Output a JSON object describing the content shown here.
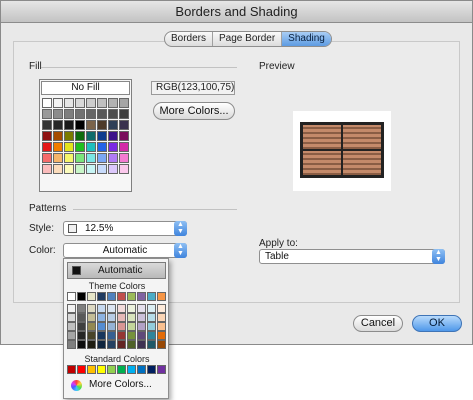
{
  "window": {
    "title": "Borders and Shading"
  },
  "tabs": [
    {
      "label": "Borders",
      "active": false
    },
    {
      "label": "Page Border",
      "active": false
    },
    {
      "label": "Shading",
      "active": true
    }
  ],
  "fill": {
    "section_label": "Fill",
    "no_fill_label": "No Fill",
    "rgb_readout": "RGB(123,100,75)",
    "more_colors_label": "More Colors...",
    "swatches": [
      "#ffffff",
      "#f2f2f2",
      "#e5e5e5",
      "#d8d8d8",
      "#cccccc",
      "#bfbfbf",
      "#b2b2b2",
      "#a5a5a5",
      "#999999",
      "#8c8c8c",
      "#7f7f7f",
      "#727272",
      "#666666",
      "#595959",
      "#4c4c4c",
      "#3f3f3f",
      "#333333",
      "#262626",
      "#191919",
      "#000000",
      "#7b644b",
      "#4d3b2a",
      "#2e3f56",
      "#39324d",
      "#8e1212",
      "#a54b00",
      "#7a7a00",
      "#0d6b0d",
      "#0d6b6b",
      "#0d3c8e",
      "#3c138a",
      "#7a0d5c",
      "#e41919",
      "#f07d00",
      "#e3e31c",
      "#1fbf1f",
      "#1fbfbf",
      "#2563e8",
      "#7b2ae3",
      "#d42aa7",
      "#f56b6b",
      "#f5b56b",
      "#f5f56b",
      "#7be57b",
      "#7be5e5",
      "#7ba7f5",
      "#b07bf5",
      "#f57bd2",
      "#fbbcbc",
      "#fbdcbc",
      "#fbfbbc",
      "#c8f5c8",
      "#c8f5f5",
      "#c8dbfb",
      "#dcc8fb",
      "#fbc8ec"
    ]
  },
  "preview": {
    "section_label": "Preview"
  },
  "patterns": {
    "section_label": "Patterns",
    "style_label": "Style:",
    "style_value": "12.5%",
    "color_label": "Color:",
    "color_value": "Automatic"
  },
  "apply_to": {
    "label": "Apply to:",
    "value": "Table"
  },
  "buttons": {
    "cancel": "Cancel",
    "ok": "OK"
  },
  "color_menu": {
    "automatic_label": "Automatic",
    "theme_heading": "Theme Colors",
    "theme_top_row": [
      "#ffffff",
      "#000000",
      "#e7e6c9",
      "#1f3a60",
      "#4f81bd",
      "#c0504d",
      "#9bbb59",
      "#8064a2",
      "#4bacc6",
      "#f79646"
    ],
    "theme_columns": [
      [
        "#f2f2f2",
        "#d8d8d8",
        "#bfbfbf",
        "#a5a5a5",
        "#7f7f7f"
      ],
      [
        "#7f7f7f",
        "#595959",
        "#3f3f3f",
        "#262626",
        "#0c0c0c"
      ],
      [
        "#ddd9c3",
        "#c4bd97",
        "#938953",
        "#494429",
        "#1d1b10"
      ],
      [
        "#c6d9f0",
        "#8db3e2",
        "#548dd4",
        "#17365d",
        "#0f243e"
      ],
      [
        "#dbe5f1",
        "#b8cce4",
        "#95b3d7",
        "#366092",
        "#244061"
      ],
      [
        "#f2dcdb",
        "#e5b9b7",
        "#d99694",
        "#953734",
        "#632423"
      ],
      [
        "#ebf1dd",
        "#d7e3bc",
        "#c3d69b",
        "#76923c",
        "#4f6128"
      ],
      [
        "#e5e0ec",
        "#ccc1d9",
        "#b2a2c7",
        "#5f497a",
        "#3f3151"
      ],
      [
        "#dbeef3",
        "#b7dde8",
        "#92cddc",
        "#31859b",
        "#205867"
      ],
      [
        "#fdeada",
        "#fbd5b5",
        "#fac08f",
        "#e36c09",
        "#974806"
      ]
    ],
    "standard_heading": "Standard Colors",
    "standard_colors": [
      "#c00000",
      "#ff0000",
      "#ffc000",
      "#ffff00",
      "#92d050",
      "#00b050",
      "#00b0f0",
      "#0070c0",
      "#002060",
      "#7030a0"
    ],
    "more_colors_label": "More Colors..."
  }
}
